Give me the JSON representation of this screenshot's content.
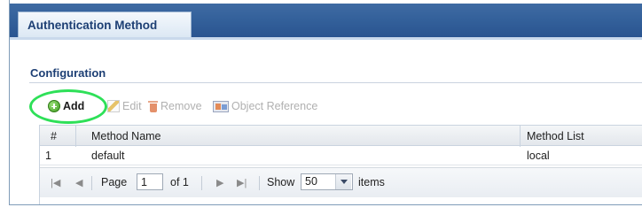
{
  "tab": {
    "label": "Authentication Method"
  },
  "section": {
    "title": "Configuration"
  },
  "toolbar": {
    "add": "Add",
    "edit": "Edit",
    "remove": "Remove",
    "object_reference": "Object Reference"
  },
  "table": {
    "columns": [
      "#",
      "Method Name",
      "Method List"
    ],
    "rows": [
      {
        "index": "1",
        "method_name": "default",
        "method_list": "local"
      }
    ]
  },
  "pager": {
    "page_label": "Page",
    "page_value": "1",
    "of_label": "of 1",
    "show_label": "Show",
    "show_value": "50",
    "items_label": "items"
  }
}
